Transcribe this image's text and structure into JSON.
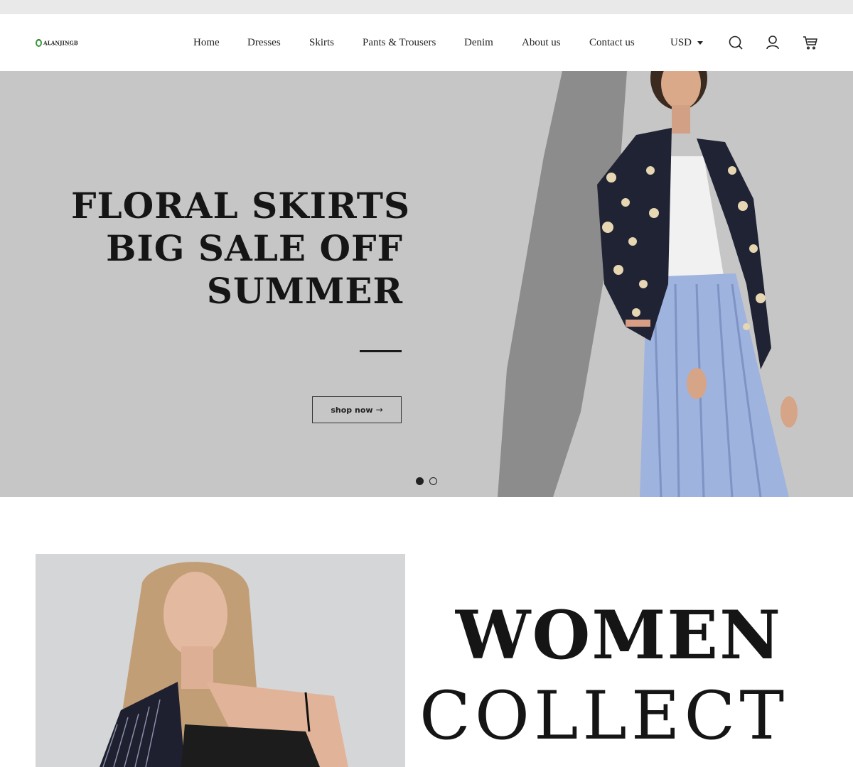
{
  "brand": {
    "name": "ALANJINGB",
    "accent": "#3a9b3a"
  },
  "nav": {
    "items": [
      {
        "label": "Home"
      },
      {
        "label": "Dresses"
      },
      {
        "label": "Skirts"
      },
      {
        "label": "Pants & Trousers"
      },
      {
        "label": "Denim"
      },
      {
        "label": "About us"
      },
      {
        "label": "Contact us"
      }
    ],
    "currency": "USD",
    "icons": [
      "search-icon",
      "account-icon",
      "cart-icon"
    ]
  },
  "hero": {
    "title_lines": [
      "FLORAL SKIRTS",
      "BIG SALE OFF",
      "SUMMER"
    ],
    "cta_label": "shop now",
    "cta_arrow": "→",
    "slides": 2,
    "active_slide": 1,
    "background": "#c6c6c6"
  },
  "collection": {
    "title_line1": "WOMEN",
    "title_line2": "COLLECT"
  }
}
